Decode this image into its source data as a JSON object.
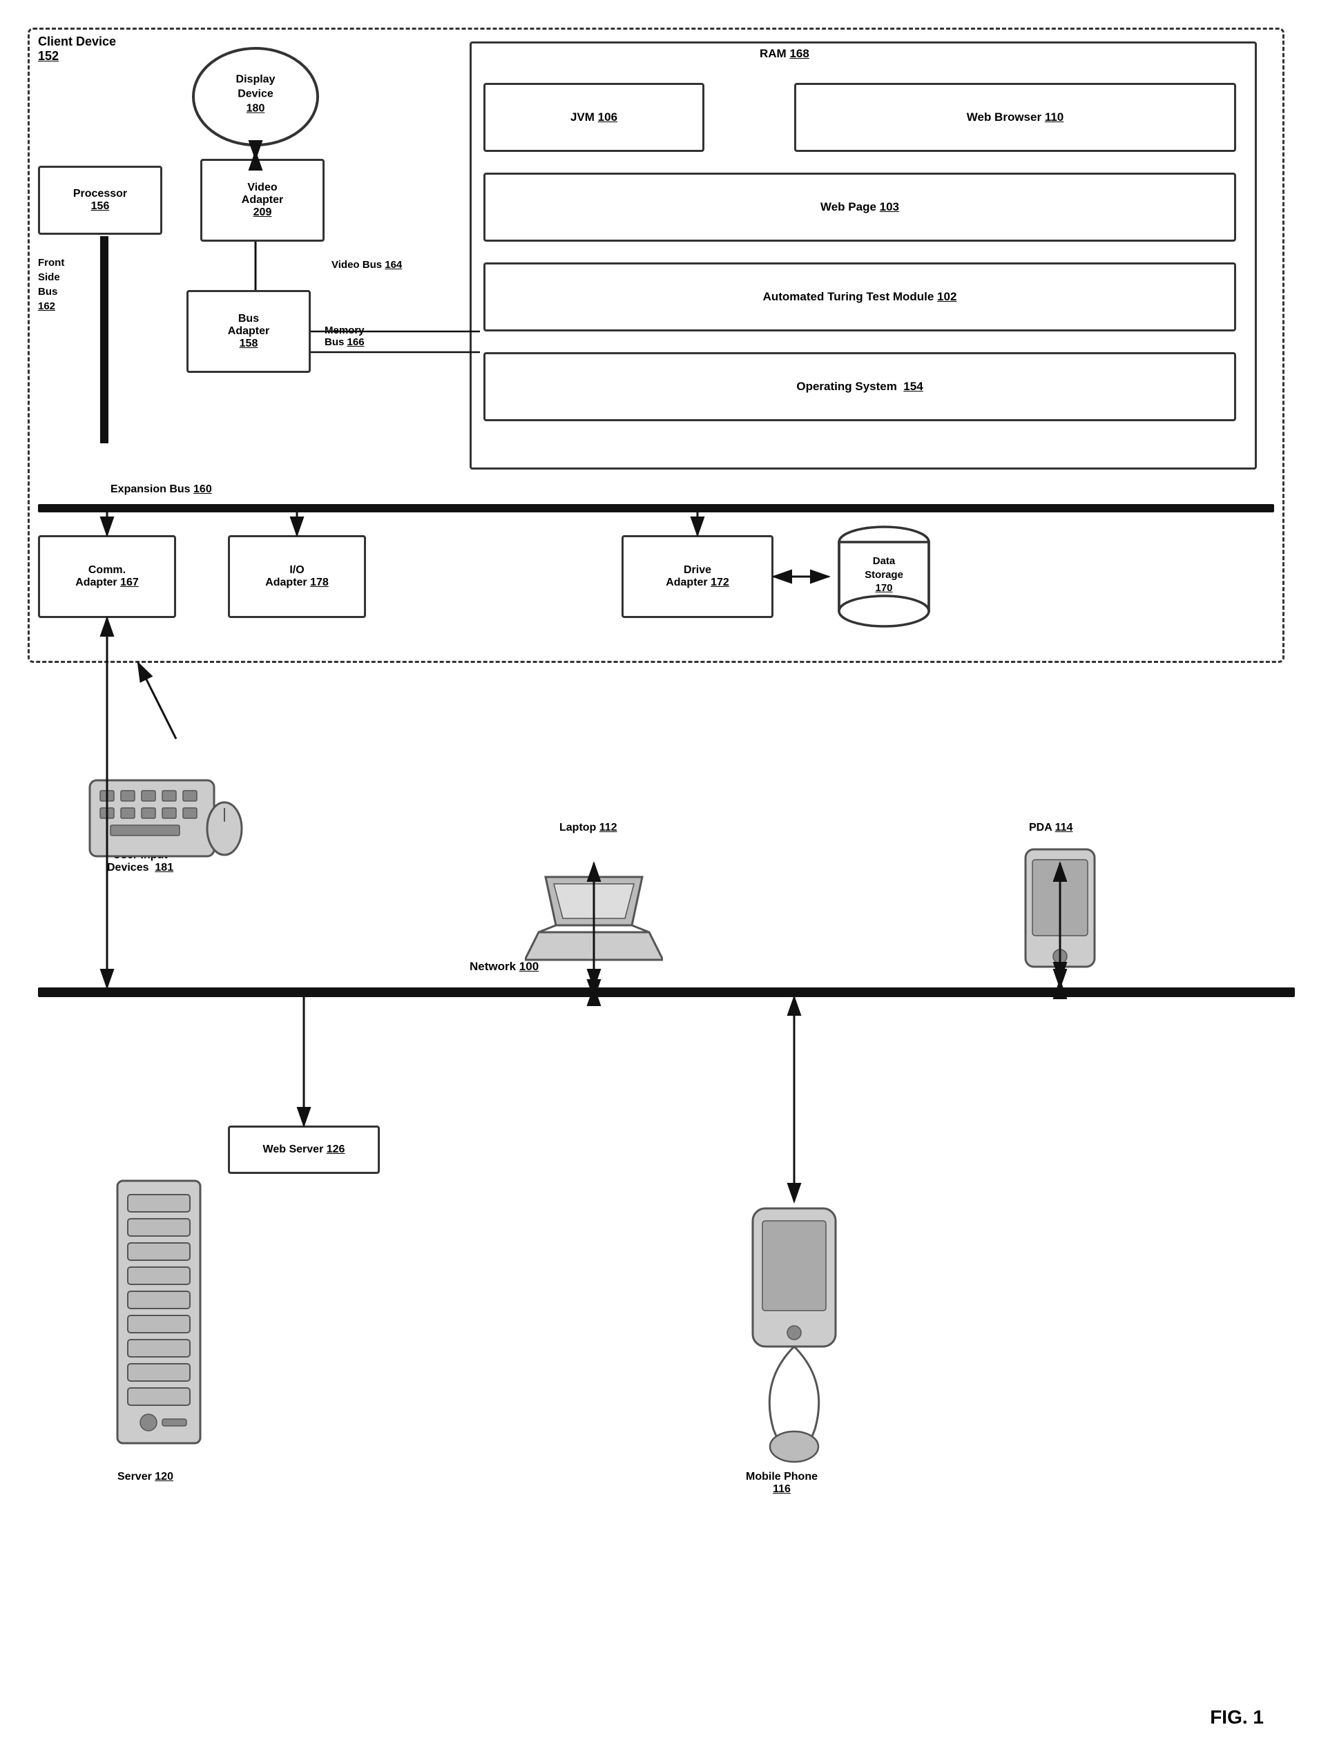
{
  "diagram": {
    "title": "FIG. 1",
    "client_device": {
      "label": "Client Device",
      "ref": "152"
    },
    "ram": {
      "label": "RAM",
      "ref": "168"
    },
    "jvm": {
      "label": "JVM",
      "ref": "106"
    },
    "web_browser": {
      "label": "Web Browser",
      "ref": "110"
    },
    "web_page": {
      "label": "Web Page",
      "ref": "103"
    },
    "attm": {
      "label": "Automated Turing Test Module",
      "ref": "102"
    },
    "os": {
      "label": "Operating System",
      "ref": "154"
    },
    "display_device": {
      "label": "Display\nDevice",
      "ref": "180"
    },
    "processor": {
      "label": "Processor",
      "ref": "156"
    },
    "fsb": {
      "label": "Front\nSide\nBus",
      "ref": "162"
    },
    "video_adapter": {
      "label": "Video\nAdapter",
      "ref": "209"
    },
    "bus_adapter": {
      "label": "Bus\nAdapter",
      "ref": "158"
    },
    "video_bus": {
      "label": "Video Bus",
      "ref": "164"
    },
    "memory_bus": {
      "label": "Memory\nBus",
      "ref": "166"
    },
    "expansion_bus": {
      "label": "Expansion Bus",
      "ref": "160"
    },
    "comm_adapter": {
      "label": "Comm.\nAdapter",
      "ref": "167"
    },
    "io_adapter": {
      "label": "I/O\nAdapter",
      "ref": "178"
    },
    "drive_adapter": {
      "label": "Drive\nAdapter",
      "ref": "172"
    },
    "data_storage": {
      "label": "Data\nStorage",
      "ref": "170"
    },
    "network": {
      "label": "Network",
      "ref": "100"
    },
    "user_input": {
      "label": "User Input\nDevices",
      "ref": "181"
    },
    "laptop": {
      "label": "Laptop",
      "ref": "112"
    },
    "pda": {
      "label": "PDA",
      "ref": "114"
    },
    "web_server": {
      "label": "Web Server",
      "ref": "126"
    },
    "server": {
      "label": "Server",
      "ref": "120"
    },
    "mobile_phone": {
      "label": "Mobile Phone",
      "ref": "116"
    }
  }
}
